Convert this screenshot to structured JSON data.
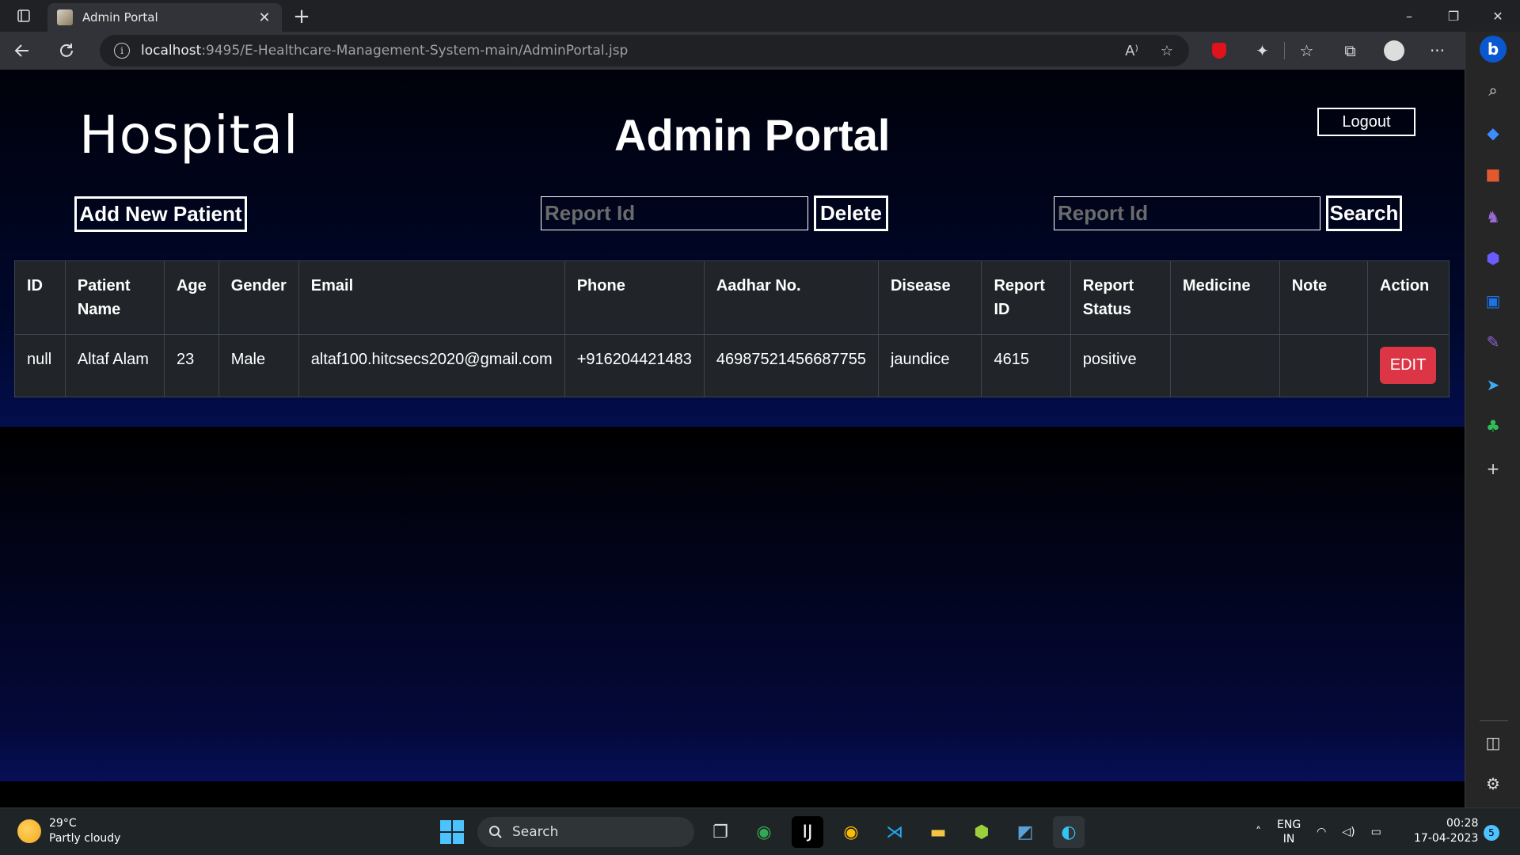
{
  "browser": {
    "tab_title": "Admin Portal",
    "tab_close": "✕",
    "new_tab": "+",
    "url_host": "localhost",
    "url_rest": ":9495/E-Healthcare-Management-System-main/AdminPortal.jsp",
    "window_controls": [
      "–",
      "❐",
      "✕"
    ]
  },
  "page": {
    "hospital_title": "Hospital",
    "portal_title": "Admin Portal",
    "logout_label": "Logout",
    "add_patient_label": "Add New Patient",
    "delete_label": "Delete",
    "search_label": "Search",
    "report_id_placeholder": "Report Id"
  },
  "table": {
    "headers": [
      "ID",
      "Patient Name",
      "Age",
      "Gender",
      "Email",
      "Phone",
      "Aadhar No.",
      "Disease",
      "Report ID",
      "Report Status",
      "Medicine",
      "Note",
      "Action"
    ],
    "rows": [
      {
        "id": "null",
        "patient_name": "Altaf Alam",
        "age": "23",
        "gender": "Male",
        "email": "altaf100.hitcsecs2020@gmail.com",
        "phone": "+916204421483",
        "aadhar": "46987521456687755",
        "disease": "jaundice",
        "report_id": "4615",
        "report_status": "positive",
        "medicine": "",
        "note": "",
        "action": "EDIT"
      }
    ]
  },
  "taskbar": {
    "temperature": "29°C",
    "weather": "Partly cloudy",
    "search_label": "Search",
    "lang_1": "ENG",
    "lang_2": "IN",
    "time": "00:28",
    "date": "17-04-2023",
    "notification_count": "5"
  },
  "colors": {
    "edit_button": "#dc3545",
    "table_bg": "#212529",
    "accent": "#4cc2ff"
  }
}
